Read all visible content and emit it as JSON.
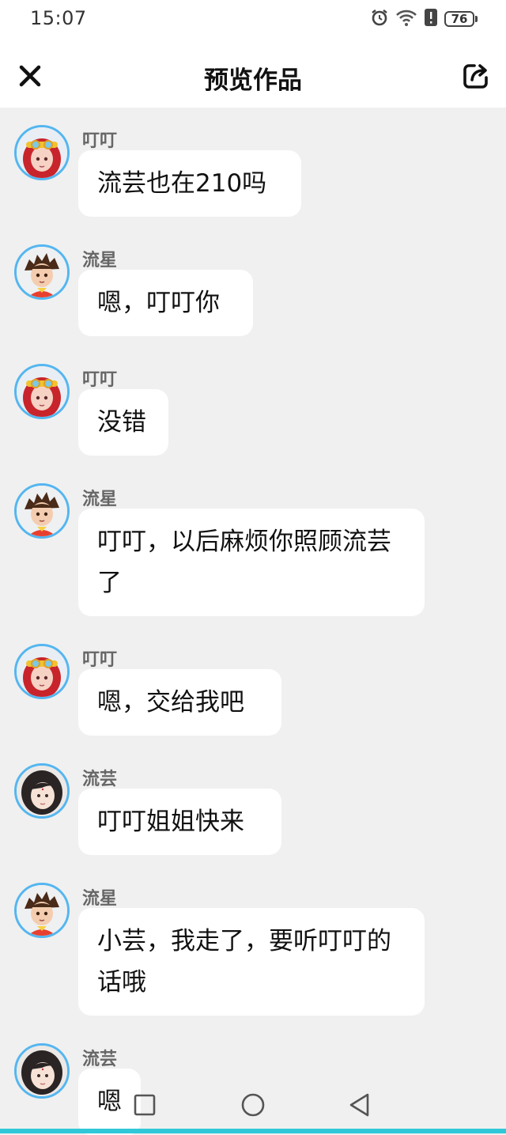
{
  "status": {
    "time": "15:07",
    "battery": "76"
  },
  "header": {
    "title": "预览作品"
  },
  "messages": [
    {
      "sender": "叮叮",
      "text": "流芸也在210吗",
      "avatar": "dingding"
    },
    {
      "sender": "流星",
      "text": "嗯，叮叮你",
      "avatar": "liuxing"
    },
    {
      "sender": "叮叮",
      "text": "没错",
      "avatar": "dingding"
    },
    {
      "sender": "流星",
      "text": "叮叮，以后麻烦你照顾流芸了",
      "avatar": "liuxing"
    },
    {
      "sender": "叮叮",
      "text": "嗯，交给我吧",
      "avatar": "dingding"
    },
    {
      "sender": "流芸",
      "text": "叮叮姐姐快来",
      "avatar": "liuyun"
    },
    {
      "sender": "流星",
      "text": "小芸，我走了，要听叮叮的话哦",
      "avatar": "liuxing"
    },
    {
      "sender": "流芸",
      "text": "嗯",
      "avatar": "liuyun"
    }
  ],
  "colors": {
    "avatar_ring": "#54b6f0",
    "background": "#f0f0f0",
    "accent_bar": "#30c8d8"
  },
  "icons": {
    "close": "close-icon",
    "share": "share-icon",
    "nav": [
      "recent-apps-icon",
      "home-icon",
      "back-icon"
    ]
  }
}
